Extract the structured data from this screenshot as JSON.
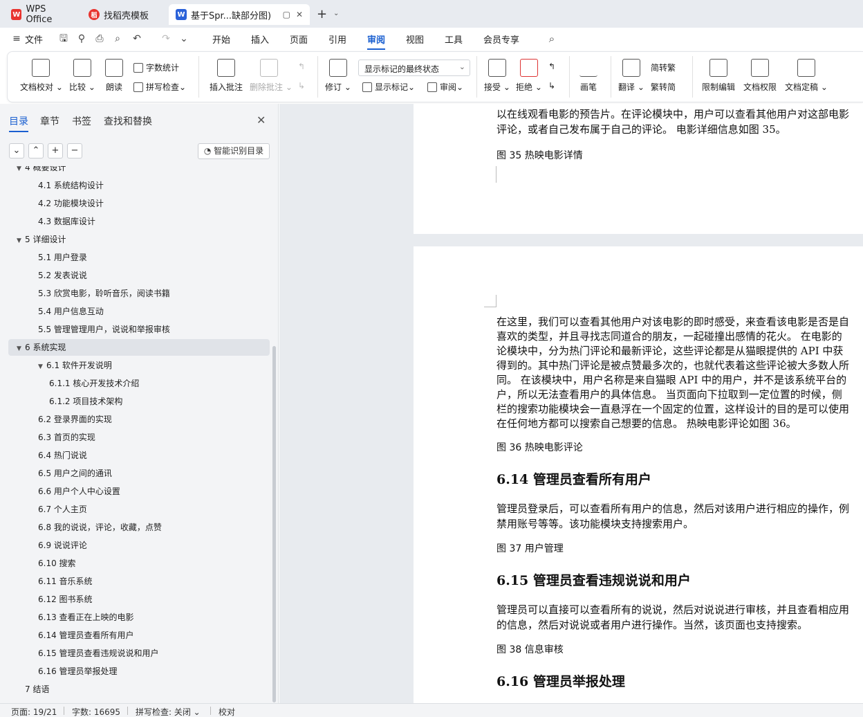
{
  "tabs": [
    {
      "label": "WPS Office",
      "logo": "W"
    },
    {
      "label": "找稻壳模板",
      "logo": "稻"
    },
    {
      "label": "基于Spr...缺部分图)",
      "logo": "W"
    }
  ],
  "menu": {
    "file": "文件",
    "items": [
      "开始",
      "插入",
      "页面",
      "引用",
      "审阅",
      "视图",
      "工具",
      "会员专享"
    ],
    "active": "审阅"
  },
  "ribbon": {
    "doc_check": "文档校对",
    "compare": "比较",
    "read_aloud": "朗读",
    "word_count": "字数统计",
    "spell_check": "拼写检查",
    "insert_comment": "插入批注",
    "delete_comment": "删除批注",
    "track_changes": "修订",
    "markup_state": "显示标记的最终状态",
    "show_markup": "显示标记",
    "review": "审阅",
    "accept": "接受",
    "reject": "拒绝",
    "ink": "画笔",
    "translate": "翻译",
    "to_traditional": "简转繁",
    "to_simplified": "繁转简",
    "restrict_edit": "限制编辑",
    "doc_permission": "文档权限",
    "doc_finalize": "文档定稿"
  },
  "leftpanel": {
    "tabs": [
      "目录",
      "章节",
      "书签",
      "查找和替换"
    ],
    "smart_toc": "智能识别目录",
    "toc": [
      {
        "text": "4 概要设计",
        "level": 1,
        "arrow": "▼"
      },
      {
        "text": "4.1 系统结构设计",
        "level": 2
      },
      {
        "text": "4.2 功能模块设计",
        "level": 2
      },
      {
        "text": "4.3 数据库设计",
        "level": 2
      },
      {
        "text": "5  详细设计",
        "level": 1,
        "arrow": "▼"
      },
      {
        "text": "5.1 用户登录",
        "level": 2
      },
      {
        "text": "5.2 发表说说",
        "level": 2
      },
      {
        "text": "5.3 欣赏电影，聆听音乐，阅读书籍",
        "level": 2
      },
      {
        "text": "5.4 用户信息互动",
        "level": 2
      },
      {
        "text": "5.5 管理管理用户，说说和举报审核",
        "level": 2
      },
      {
        "text": "6  系统实现",
        "level": 1,
        "arrow": "▼",
        "selected": true
      },
      {
        "text": "6.1 软件开发说明",
        "level": 2,
        "arrow": "▼"
      },
      {
        "text": "6.1.1 核心开发技术介绍",
        "level": 3
      },
      {
        "text": "6.1.2 项目技术架构",
        "level": 3
      },
      {
        "text": "6.2 登录界面的实现",
        "level": 2
      },
      {
        "text": "6.3 首页的实现",
        "level": 2
      },
      {
        "text": "6.4 热门说说",
        "level": 2
      },
      {
        "text": "6.5 用户之间的通讯",
        "level": 2
      },
      {
        "text": "6.6 用户个人中心设置",
        "level": 2
      },
      {
        "text": "6.7 个人主页",
        "level": 2
      },
      {
        "text": "6.8 我的说说，评论，收藏，点赞",
        "level": 2
      },
      {
        "text": "6.9 说说评论",
        "level": 2
      },
      {
        "text": "6.10 搜索",
        "level": 2
      },
      {
        "text": "6.11 音乐系统",
        "level": 2
      },
      {
        "text": "6.12 图书系统",
        "level": 2
      },
      {
        "text": "6.13 查看正在上映的电影",
        "level": 2
      },
      {
        "text": "6.14 管理员查看所有用户",
        "level": 2
      },
      {
        "text": "6.15 管理员查看违规说说和用户",
        "level": 2
      },
      {
        "text": "6.16 管理员举报处理",
        "level": 2
      },
      {
        "text": "7  结语",
        "level": 1
      }
    ]
  },
  "document": {
    "page1_lines": [
      "以在线观看电影的预告片。在评论模块中，用户可以查看其他用户对这部电影",
      "评论，或者自己发布属于自己的评论。  电影详细信息如图 35。"
    ],
    "page1_caption": "图 35  热映电影详情",
    "page2_para1": [
      "在这里，我们可以查看其他用户对该电影的即时感受，来查看该电影是否是自",
      "喜欢的类型，并且寻找志同道合的朋友，一起碰撞出感情的花火。  在电影的",
      "论模块中，分为热门评论和最新评论，这些评论都是从猫眼提供的 API 中获",
      "得到的。其中热门评论是被点赞最多次的，也就代表着这些评论被大多数人所",
      "同。  在该模块中，用户名称是来自猫眼 API 中的用户，并不是该系统平台的",
      "户，所以无法查看用户的具体信息。  当页面向下拉取到一定位置的时候，侧",
      "栏的搜索功能模块会一直悬浮在一个固定的位置，这样设计的目的是可以使用",
      "在任何地方都可以搜索自己想要的信息。  热映电影评论如图 36。"
    ],
    "caption36": "图 36  热映电影评论",
    "h614": "6.14 管理员查看所有用户",
    "para614": [
      "管理员登录后，可以查看所有用户的信息，然后对该用户进行相应的操作，例",
      "禁用账号等等。该功能模块支持搜索用户。"
    ],
    "caption37": "图 37  用户管理",
    "h615": "6.15 管理员查看违规说说和用户",
    "para615": [
      "管理员可以直接可以查看所有的说说，然后对说说进行审核，并且查看相应用",
      "的信息，然后对说说或者用户进行操作。当然，该页面也支持搜索。"
    ],
    "caption38": "图 38  信息审核",
    "h616": "6.16 管理员举报处理"
  },
  "status": {
    "page": "页面: 19/21",
    "words": "字数: 16695",
    "spell": "拼写检查: 关闭",
    "proof": "校对"
  },
  "colors": {
    "accent": "#1a5fd0",
    "wps_red": "#e8342f"
  }
}
